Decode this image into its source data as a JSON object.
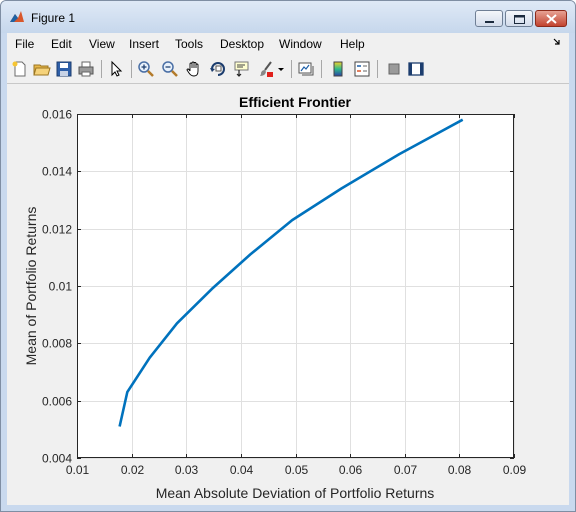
{
  "window": {
    "title": "Figure 1"
  },
  "menubar": {
    "items": [
      "File",
      "Edit",
      "View",
      "Insert",
      "Tools",
      "Desktop",
      "Window",
      "Help"
    ]
  },
  "toolbar": {
    "icons": [
      "new-figure-icon",
      "open-file-icon",
      "save-icon",
      "print-icon",
      "select-arrow-icon",
      "zoom-in-icon",
      "zoom-out-icon",
      "pan-hand-icon",
      "rotate-3d-icon",
      "data-cursor-icon",
      "brush-icon",
      "brush-dropdown-icon",
      "link-plot-icon",
      "colorbar-icon",
      "legend-icon",
      "hide-plot-tools-icon",
      "show-plot-tools-icon"
    ]
  },
  "colors": {
    "line": "#0072bd",
    "figure_bg": "#f0f0f0",
    "axes_bg": "#ffffff",
    "grid": "#e0e0e0"
  },
  "chart_data": {
    "type": "line",
    "title": "Efficient Frontier",
    "xlabel": "Mean Absolute Deviation of Portfolio Returns",
    "ylabel": "Mean of Portfolio Returns",
    "xlim": [
      0.01,
      0.09
    ],
    "ylim": [
      0.004,
      0.016
    ],
    "xticks": [
      "0.01",
      "0.02",
      "0.03",
      "0.04",
      "0.05",
      "0.06",
      "0.07",
      "0.08",
      "0.09"
    ],
    "yticks": [
      "0.004",
      "0.006",
      "0.008",
      "0.01",
      "0.012",
      "0.014",
      "0.016"
    ],
    "grid": true,
    "series": [
      {
        "x": [
          0.0178,
          0.0192,
          0.0233,
          0.0283,
          0.0347,
          0.0417,
          0.0494,
          0.0584,
          0.069,
          0.0806
        ],
        "y": [
          0.0051,
          0.0063,
          0.0075,
          0.0087,
          0.0099,
          0.0111,
          0.0123,
          0.0134,
          0.0146,
          0.0158
        ]
      }
    ]
  }
}
